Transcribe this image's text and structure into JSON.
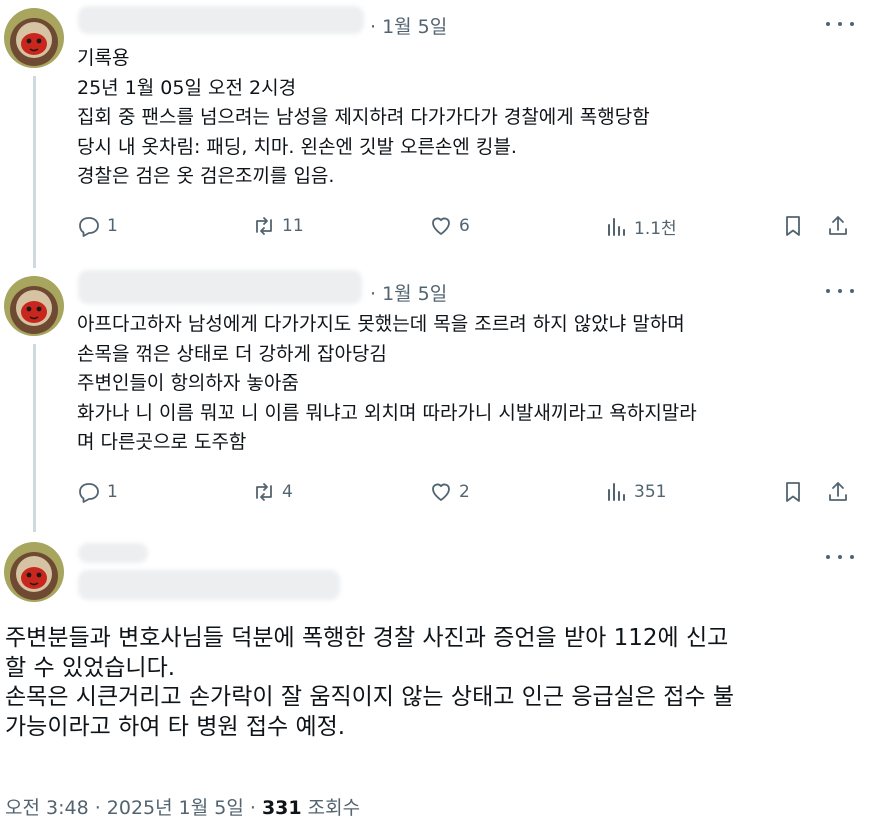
{
  "colors": {
    "text": "#0f1419",
    "secondary": "#536471",
    "thread_line": "#cfd9de"
  },
  "replies": [
    {
      "date": "· 1월 5일",
      "lines": [
        "기록용",
        "25년 1월 05일 오전 2시경",
        "집회 중 팬스를 넘으려는 남성을 제지하려 다가가다가 경찰에게 폭행당함",
        "당시 내 옷차림: 패딩, 치마. 왼손엔 깃발 오른손엔 킹블.",
        "경찰은 검은 옷 검은조끼를 입음."
      ],
      "stats": {
        "replies": "1",
        "reposts": "11",
        "likes": "6",
        "views": "1.1천"
      }
    },
    {
      "date": "· 1월 5일",
      "lines": [
        "아프다고하자 남성에게 다가가지도 못했는데 목을 조르려 하지 않았냐 말하며",
        "손목을 꺾은 상태로 더 강하게 잡아당김",
        "주변인들이 항의하자 놓아줌",
        "화가나 니 이름 뭐꼬 니 이름 뭐냐고 외치며 따라가니 시발새끼라고 욕하지말라",
        "며 다른곳으로 도주함"
      ],
      "stats": {
        "replies": "1",
        "reposts": "4",
        "likes": "2",
        "views": "351"
      }
    }
  ],
  "main_post": {
    "lines": [
      "주변분들과 변호사님들 덕분에 폭행한 경찰 사진과 증언을 받아 112에 신고",
      "할 수 있었습니다.",
      "손목은 시큰거리고 손가락이 잘 움직이지 않는 상태고 인근 응급실은 접수 불",
      "가능이라고 하여 타 병원 접수 예정."
    ],
    "time": "오전 3:48 · 2025년 1월 5일 · ",
    "view_count": "331",
    "view_label": "조회수"
  },
  "icons": {
    "reply": "reply-bubble-icon",
    "repost": "repost-arrows-icon",
    "like": "heart-icon",
    "views": "analytics-bars-icon",
    "bookmark": "bookmark-icon",
    "share": "share-upload-icon",
    "more": "more-dots-icon"
  }
}
